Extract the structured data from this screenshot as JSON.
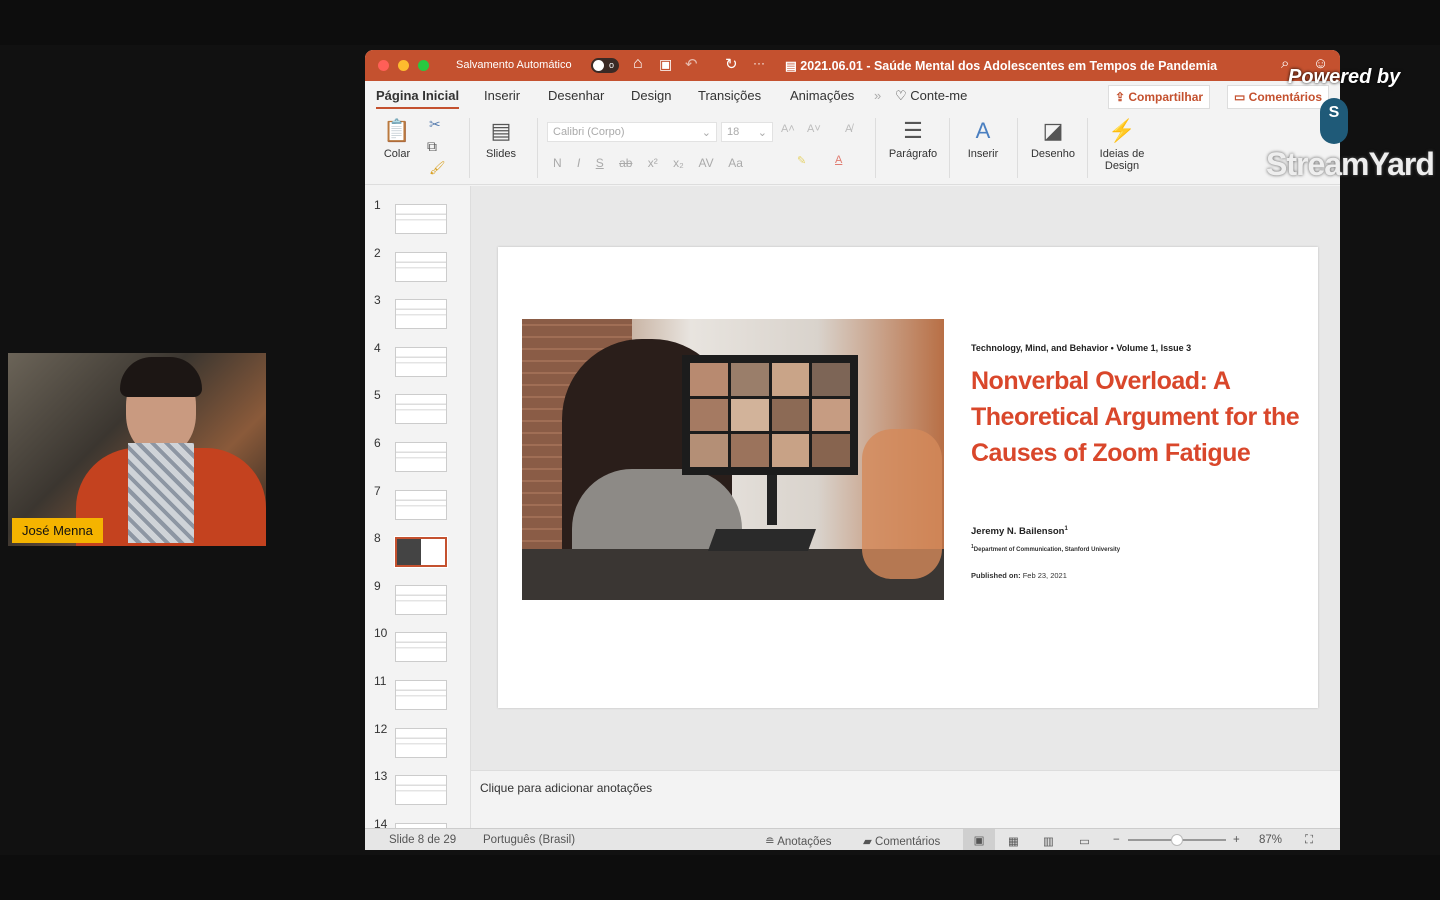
{
  "webcam": {
    "name": "José Menna"
  },
  "branding": {
    "powered_by": "Powered by",
    "logo": "StreamYard"
  },
  "titlebar": {
    "autosave_label": "Salvamento Automático",
    "autosave_state": "o",
    "doc_title": "2021.06.01 - Saúde Mental dos Adolescentes em Tempos de Pandemia",
    "accent": "#c4512f"
  },
  "tabs": [
    "Página Inicial",
    "Inserir",
    "Desenhar",
    "Design",
    "Transições",
    "Animações",
    "Conte-me"
  ],
  "actions": {
    "share": "Compartilhar",
    "comments": "Comentários"
  },
  "ribbon": {
    "paste": "Colar",
    "slides": "Slides",
    "font": "Calibri (Corpo)",
    "size": "18",
    "paragraph": "Parágrafo",
    "insert": "Inserir",
    "draw": "Desenho",
    "design_ideas": "Ideias de Design",
    "fmt": [
      "N",
      "I",
      "S",
      "ab",
      "x²",
      "x₂",
      "AV",
      "Aa"
    ]
  },
  "thumbnails": [
    "1",
    "2",
    "3",
    "4",
    "5",
    "6",
    "7",
    "8",
    "9",
    "10",
    "11",
    "12",
    "13",
    "14"
  ],
  "selected_slide": 8,
  "slide": {
    "journal": "Technology, Mind, and Behavior • Volume 1, Issue 3",
    "title": "Nonverbal Overload: A Theoretical Argument for the Causes of Zoom Fatigue",
    "author": "Jeremy N. Bailenson",
    "author_sup": "1",
    "affiliation": "Department of Communication, Stanford University",
    "published_label": "Published on:",
    "published_date": "Feb 23, 2021",
    "title_color": "#d9472b"
  },
  "notes_placeholder": "Clique para adicionar anotações",
  "status": {
    "slide": "Slide 8 de 29",
    "language": "Português (Brasil)",
    "notes": "Anotações",
    "comments": "Comentários",
    "zoom": "87%",
    "zoom_level": 87
  }
}
